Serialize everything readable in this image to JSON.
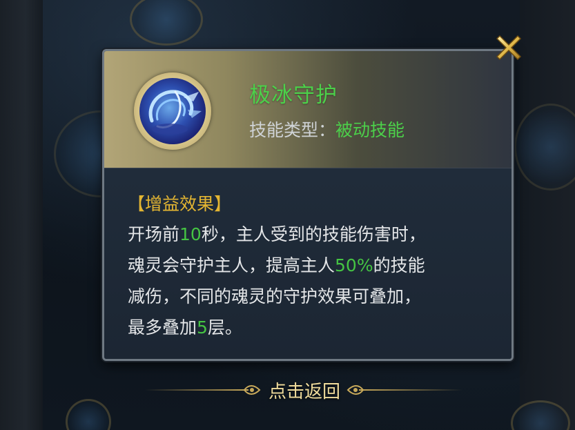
{
  "skill": {
    "name": "极冰守护",
    "type_label": "技能类型：",
    "type_value": "被动技能",
    "icon": "ice-guardian-icon"
  },
  "effect": {
    "title": "【增益效果】",
    "lines": [
      [
        {
          "t": "开场前",
          "hl": false
        },
        {
          "t": "10",
          "hl": true
        },
        {
          "t": "秒，主人受到的技能伤害时，",
          "hl": false
        }
      ],
      [
        {
          "t": "魂灵会守护主人，提高主人",
          "hl": false
        },
        {
          "t": "50%",
          "hl": true
        },
        {
          "t": "的技能",
          "hl": false
        }
      ],
      [
        {
          "t": "减伤，不同的魂灵的守护效果可叠加，",
          "hl": false
        }
      ],
      [
        {
          "t": "最多叠加",
          "hl": false
        },
        {
          "t": "5",
          "hl": true
        },
        {
          "t": "层。",
          "hl": false
        }
      ]
    ]
  },
  "back_button": {
    "label": "点击返回"
  },
  "colors": {
    "highlight": "#45c443",
    "section_title": "#e3b532",
    "close_icon": "#e0b84a"
  }
}
